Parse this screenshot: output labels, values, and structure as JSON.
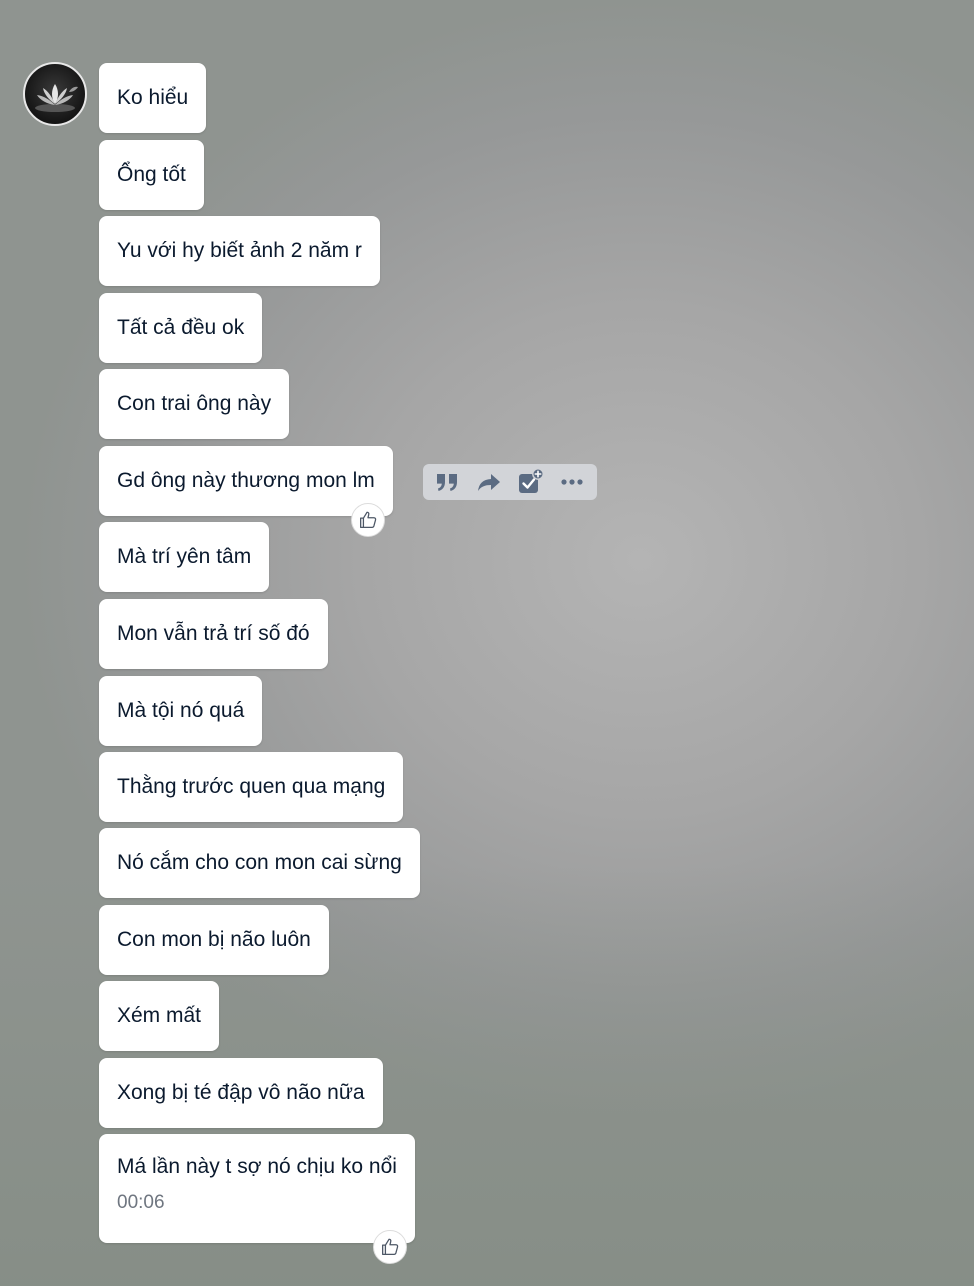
{
  "chat": {
    "sender": {
      "avatar_icon": "lotus-avatar-icon"
    },
    "messages": [
      {
        "text": "Ko hiểu"
      },
      {
        "text": "Ổng tốt"
      },
      {
        "text": "Yu với hy biết ảnh 2 năm r"
      },
      {
        "text": "Tất cả đều ok"
      },
      {
        "text": "Con trai ông này"
      },
      {
        "text": "Gd ông này thương mon lm"
      },
      {
        "text": "Mà trí yên tâm"
      },
      {
        "text": "Mon vẫn trả trí số đó"
      },
      {
        "text": "Mà tội nó quá"
      },
      {
        "text": "Thằng trước quen qua mạng"
      },
      {
        "text": "Nó cắm cho con mon cai sừng"
      },
      {
        "text": "Con mon bị não luôn"
      },
      {
        "text": "Xém mất"
      },
      {
        "text": "Xong bị té đập vô não nữa"
      },
      {
        "text": "Má lần này t sợ nó chịu ko nổi",
        "time": "00:06"
      }
    ]
  },
  "hover_toolbar": {
    "icons": [
      "quote-icon",
      "forward-icon",
      "add-task-icon",
      "more-icon"
    ]
  },
  "colors": {
    "bubble_bg": "#ffffff",
    "text": "#0b1a2e",
    "toolbar_bg": "#d2d4d8",
    "toolbar_icon": "#5b6b82"
  }
}
